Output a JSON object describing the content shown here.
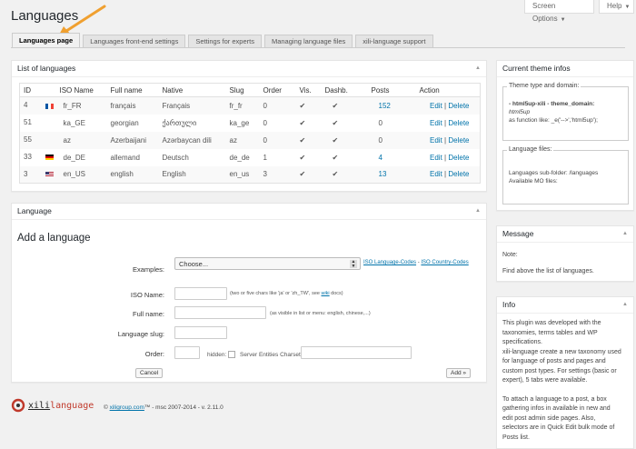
{
  "header": {
    "title": "Languages",
    "screen_options": "Screen Options",
    "help": "Help"
  },
  "tabs": [
    {
      "label": "Languages page",
      "active": true
    },
    {
      "label": "Languages front-end settings"
    },
    {
      "label": "Settings for experts"
    },
    {
      "label": "Managing language files"
    },
    {
      "label": "xili-language support"
    }
  ],
  "list": {
    "title": "List of languages",
    "columns": [
      "ID",
      "ISO Name",
      "Full name",
      "Native",
      "Slug",
      "Order",
      "Vis.",
      "Dashb.",
      "Posts",
      "Action"
    ],
    "rows": [
      {
        "id": "4",
        "iso": "fr_FR",
        "full": "français",
        "native": "Français",
        "slug": "fr_fr",
        "order": "0",
        "vis": "✔",
        "dash": "✔",
        "posts": "152",
        "flag": "fr"
      },
      {
        "id": "51",
        "iso": "ka_GE",
        "full": "georgian",
        "native": "ქართული",
        "slug": "ka_ge",
        "order": "0",
        "vis": "✔",
        "dash": "✔",
        "posts": "0",
        "flag": ""
      },
      {
        "id": "55",
        "iso": "az",
        "full": "Azerbaijani",
        "native": "Azərbaycan dili",
        "slug": "az",
        "order": "0",
        "vis": "✔",
        "dash": "✔",
        "posts": "0",
        "flag": ""
      },
      {
        "id": "33",
        "iso": "de_DE",
        "full": "allemand",
        "native": "Deutsch",
        "slug": "de_de",
        "order": "1",
        "vis": "✔",
        "dash": "✔",
        "posts": "4",
        "flag": "de"
      },
      {
        "id": "3",
        "iso": "en_US",
        "full": "english",
        "native": "English",
        "slug": "en_us",
        "order": "3",
        "vis": "✔",
        "dash": "✔",
        "posts": "13",
        "flag": "us"
      }
    ],
    "edit_label": "Edit",
    "sep": "|",
    "delete_label": "Delete"
  },
  "language": {
    "title": "Language",
    "add_title": "Add a language",
    "examples_label": "Examples:",
    "select_value": "Choose...",
    "iso_codes_link": "ISO Language-Codes",
    "link_sep": "-",
    "country_codes_link": "ISO Country-Codes",
    "iso_name_label": "ISO Name:",
    "iso_hint_pre": "(two or five chars like 'ja' or 'zh_TW', see ",
    "iso_hint_link": "wiki",
    "iso_hint_post": " docs)",
    "full_name_label": "Full name:",
    "full_name_hint": "(as visible in list or menu: english, chinese,...)",
    "slug_label": "Language slug:",
    "order_label": "Order:",
    "hidden_label": "hidden:",
    "charset_label": "Server Entities Charset:",
    "cancel_label": "Cancel",
    "add_label": "Add »"
  },
  "theme": {
    "title": "Current theme infos",
    "legend1": "Theme type and domain:",
    "line1a": "- html5up-xili - theme_domain:",
    "line1b": "html5up",
    "line1c": "as function like: _e('-->','html5up');",
    "legend2": "Language files:",
    "line2a": "Languages sub-folder: /languages",
    "line2b": "Available MO files:"
  },
  "message": {
    "title": "Message",
    "note": "Note:",
    "text": "Find above the list of languages."
  },
  "info": {
    "title": "Info",
    "p1": [
      "This plugin was developed with the",
      "taxonomies, terms tables and WP",
      "specifications.",
      "xili-language create a new taxonomy used",
      "for language of posts and pages and",
      "custom post types. For settings (basic or",
      "expert), 5 tabs were available."
    ],
    "p2": [
      "To attach a language to a post, a box",
      "gathering infos in available in new and",
      "edit post admin side pages. Also,",
      "selectors are in Quick Edit bulk mode of",
      "Posts list."
    ]
  },
  "footer": {
    "logo_a": "xili",
    "logo_b": "language",
    "copy_pre": "© ",
    "copy_link": "xiligroup.com",
    "copy_post": "™ - msc 2007-2014 - v. 2.11.0"
  },
  "colors": {
    "accent": "#0073aa",
    "annotation_arrow": "#f0a030"
  }
}
